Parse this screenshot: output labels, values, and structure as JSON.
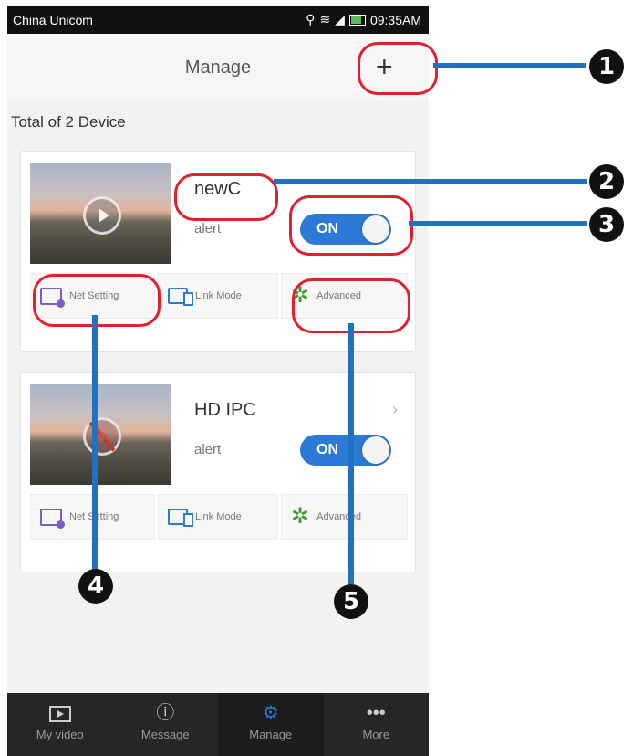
{
  "status_bar": {
    "carrier": "China Unicom",
    "time": "09:35AM",
    "icons": [
      "usb-icon",
      "wifi-icon",
      "signal-icon",
      "battery-icon"
    ]
  },
  "header": {
    "title": "Manage",
    "add_label": "+"
  },
  "summary": {
    "total": "Total of 2 Device"
  },
  "devices": [
    {
      "name": "newC",
      "alert_label": "alert",
      "toggle_label": "ON",
      "actions": [
        "Net Setting",
        "Link Mode",
        "Advanced"
      ]
    },
    {
      "name": "HD IPC",
      "alert_label": "alert",
      "toggle_label": "ON",
      "chevron": "›",
      "actions": [
        "Net Setting",
        "Link Mode",
        "Advanced"
      ]
    }
  ],
  "tabs": [
    {
      "label": "My video",
      "icon": "video-icon"
    },
    {
      "label": "Message",
      "icon": "message-icon"
    },
    {
      "label": "Manage",
      "icon": "gear-icon",
      "active": true
    },
    {
      "label": "More",
      "icon": "more-icon"
    }
  ],
  "callouts": [
    "1",
    "2",
    "3",
    "4",
    "5"
  ],
  "colors": {
    "accent": "#2c7ad6",
    "callout_ring": "#e0202f",
    "callout_line": "#1e72c1",
    "tabbar": "#262626"
  }
}
